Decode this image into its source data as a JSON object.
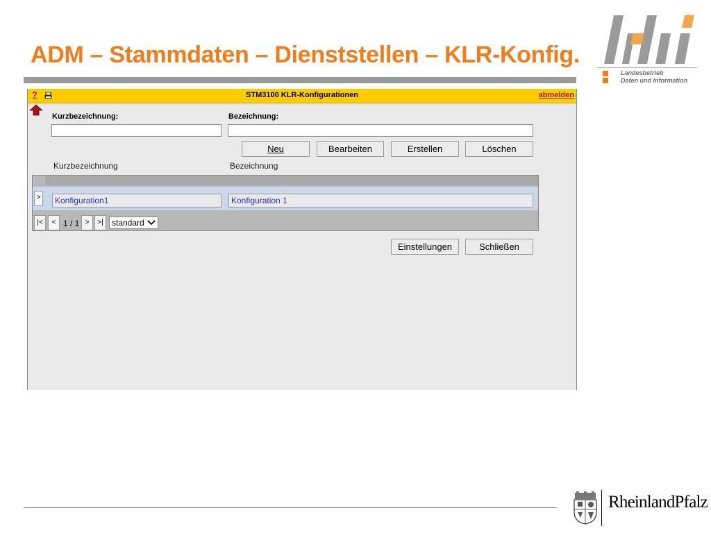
{
  "slide": {
    "title": "ADM – Stammdaten – Dienststellen – KLR-Konfig."
  },
  "logo": {
    "line1": "Landesbetrieb",
    "line2": "Daten und Information"
  },
  "app": {
    "help": "?",
    "title": "STM3100 KLR-Konfigurationen",
    "logout": "abmelden",
    "filter": {
      "kurz_label": "Kurzbezeichnung:",
      "bez_label": "Bezeichnung:",
      "kurz_value": "",
      "bez_value": ""
    },
    "buttons": {
      "neu": "Neu",
      "bearbeiten": "Bearbeiten",
      "erstellen": "Erstellen",
      "loeschen": "Löschen",
      "einstellungen": "Einstellungen",
      "schliessen": "Schließen"
    },
    "columns": [
      "Kurzbezeichnung",
      "Bezeichnung"
    ],
    "rows": [
      {
        "marker": ">",
        "kurz": "Konfiguration1",
        "bez": "Konfiguration 1"
      }
    ],
    "pager": {
      "first": "|<",
      "prev": "<",
      "info": "1 / 1",
      "next": ">",
      "last": ">|",
      "view": "standard"
    }
  },
  "footer": {
    "state_name": "RheinlandPfalz"
  }
}
